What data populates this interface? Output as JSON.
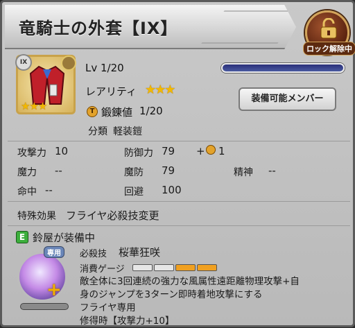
{
  "title": "竜騎士の外套【IX】",
  "lock": {
    "label": "ロック解除中",
    "icon": "unlocked-padlock-icon"
  },
  "item": {
    "icon": "red-coat-icon",
    "rank_badge": "IX",
    "icon_stars": "★★★",
    "level_label": "Lv",
    "level_value": "1/20",
    "level_progress": 0.0,
    "rarity_label": "レアリティ",
    "rarity_stars": "★★★",
    "forge_label": "鍛錬値",
    "forge_value": "1/20",
    "category_label": "分類",
    "category_value": "軽装鎧"
  },
  "equip_button": "装備可能メンバー",
  "stats": {
    "atk_label": "攻撃力",
    "atk": "10",
    "def_label": "防御力",
    "def": "79",
    "def_bonus": "+",
    "def_bonus_val": "1",
    "mag_label": "魔力",
    "mag": "--",
    "mdef_label": "魔防",
    "mdef": "79",
    "spr_label": "精神",
    "spr": "--",
    "acc_label": "命中",
    "acc": "--",
    "eva_label": "回避",
    "eva": "100"
  },
  "effect": {
    "label": "特殊効果",
    "value": "フライヤ必殺技変更"
  },
  "equip": {
    "badge": "E",
    "equipped_text": "鈴屋が装備中",
    "exclusive_tag": "専用",
    "skill_tag": "必殺技",
    "skill_name": "桜華狂咲",
    "gauge_label": "消費ゲージ",
    "gauge_segments": 4,
    "gauge_filled": 2,
    "desc_lines": [
      "敵全体に3回連続の強力な風属性遠距離物理攻撃+自",
      "身のジャンプを3ターン即時着地攻撃にする",
      "フライヤ専用",
      "修得時【攻撃力+10】"
    ]
  },
  "colors": {
    "accent_gold": "#f2b800",
    "gauge_on": "#f0a020",
    "lv_bar": "#2a2f7a"
  }
}
